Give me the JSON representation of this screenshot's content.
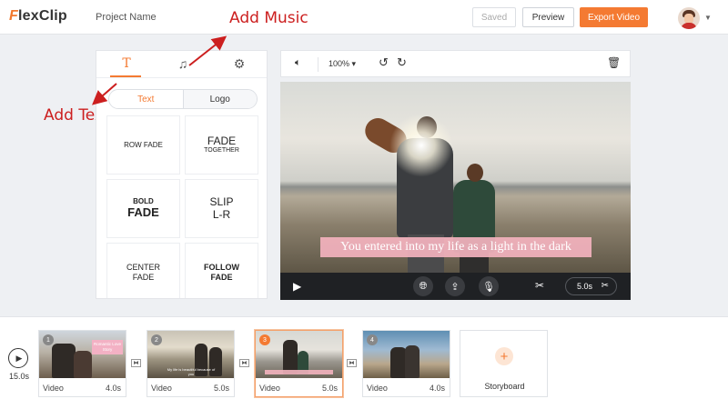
{
  "header": {
    "logo": "FlexClip",
    "project_name": "Project Name",
    "saved_label": "Saved",
    "preview_label": "Preview",
    "export_label": "Export Video"
  },
  "annotations": {
    "add_music": "Add Music",
    "add_text": "Add Text"
  },
  "left_panel": {
    "tabs": [
      {
        "name": "text",
        "icon": "text-icon",
        "active": true
      },
      {
        "name": "music",
        "icon": "music-note-icon",
        "active": false
      },
      {
        "name": "settings",
        "icon": "gear-icon",
        "active": false
      }
    ],
    "segments": {
      "text": "Text",
      "logo": "Logo",
      "active": "Text"
    },
    "cards": [
      {
        "label": "ROW FADE"
      },
      {
        "line1": "FADE",
        "line2": "TOGETHER"
      },
      {
        "line1": "BOLD",
        "line2": "FADE"
      },
      {
        "line1": "SLIP",
        "line2": "L-R"
      },
      {
        "line1": "CENTER",
        "line2": "FADE"
      },
      {
        "line1": "FOLLOW",
        "line2": "FADE"
      }
    ]
  },
  "preview": {
    "zoom": "100%",
    "caption": "You entered into my life as a light in the dark",
    "duration": "5.0s"
  },
  "timeline": {
    "total": "15.0s",
    "clips": [
      {
        "number": "1",
        "label": "Video",
        "duration": "4.0s",
        "tag": "Romantic Love Story",
        "active": false
      },
      {
        "number": "2",
        "label": "Video",
        "duration": "5.0s",
        "tag": "My life is beautiful because of you",
        "active": false
      },
      {
        "number": "3",
        "label": "Video",
        "duration": "5.0s",
        "active": true
      },
      {
        "number": "4",
        "label": "Video",
        "duration": "4.0s",
        "active": false
      }
    ],
    "storyboard_label": "Storyboard"
  },
  "colors": {
    "accent": "#f47a32",
    "annotation": "#cc1f1f",
    "caption_bg": "#f3b2be"
  }
}
